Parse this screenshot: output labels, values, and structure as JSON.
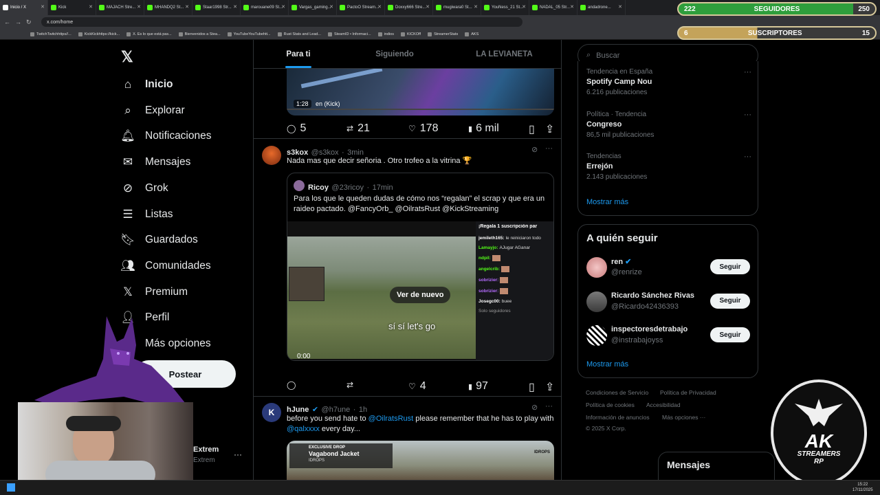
{
  "browser": {
    "tabs": [
      "Inicio / X",
      "Kick",
      "MAJACH Stre...",
      "MHANDQ2 St...",
      "Staar1998 Str...",
      "marouane09 St...",
      "Vargas_gaming...",
      "PactoO Stream...",
      "Doxxy666 Stre...",
      "mugiwara0 St...",
      "YouNess_21 St...",
      "NADAL_05 Str...",
      "andadrone..."
    ],
    "url": "x.com/home",
    "bookmarks": [
      "TwitchTwitchhttps//...",
      "KickKickhttps://kick...",
      "X. Es lo que está pas...",
      "Bienvenidos a Stea...",
      "YouTubeYouTubehtt...",
      "Rust Stats and Lead...",
      "SteamID • Informaci...",
      "indios",
      "KICKOff",
      "StreamerStats",
      "AKS"
    ]
  },
  "overlay": {
    "followers": {
      "current": "222",
      "label": "SEGUIDORES",
      "goal": "250",
      "progress": 0.888
    },
    "subs": {
      "current": "6",
      "label": "SUSCRIPTORES",
      "goal": "15",
      "progress": 0.4
    },
    "logo_text": [
      "AK",
      "STREAMERS",
      "RP"
    ],
    "webcam_user": "Extrem",
    "webcam_handle": "Extrem"
  },
  "sidebar": {
    "items": [
      {
        "label": "Inicio",
        "icon": "home-icon"
      },
      {
        "label": "Explorar",
        "icon": "search-icon"
      },
      {
        "label": "Notificaciones",
        "icon": "bell-icon"
      },
      {
        "label": "Mensajes",
        "icon": "mail-icon"
      },
      {
        "label": "Grok",
        "icon": "grok-icon"
      },
      {
        "label": "Listas",
        "icon": "list-icon"
      },
      {
        "label": "Guardados",
        "icon": "bookmark-icon"
      },
      {
        "label": "Comunidades",
        "icon": "communities-icon"
      },
      {
        "label": "Premium",
        "icon": "x-logo-icon"
      },
      {
        "label": "Perfil",
        "icon": "profile-icon"
      },
      {
        "label": "Más opciones",
        "icon": "more-icon"
      }
    ],
    "post_button": "Postear",
    "more_dots": "···"
  },
  "feed": {
    "tabs": [
      "Para ti",
      "Siguiendo",
      "LA LEVIANETA"
    ],
    "video_top": {
      "duration": "1:28",
      "overlay_text": "en (Kick)"
    },
    "actions_1": {
      "replies": "5",
      "reposts": "21",
      "likes": "178",
      "views": "6 mil"
    },
    "tweet1": {
      "name": "s3kox",
      "handle": "@s3kox",
      "time": "3min",
      "text": "Nada mas que decir señoria . Otro trofeo a la vitrina 🏆",
      "quote": {
        "name": "Ricoy",
        "handle": "@23ricoy",
        "time": "17min",
        "text_prefix": "Para los que le queden dudas de cómo nos “regalan” el scrap y que era un raideo pactado. ",
        "mentions": "@FancyOrb_ @OilratsRust @KickStreaming",
        "replay": "Ver de nuevo",
        "subtitle": "sí sí let's go",
        "time_display": "0:00",
        "chat_header": "¡Regala 1 suscripción par",
        "chat": [
          {
            "user": "jemileth165:",
            "msg": "le reiniciaron todo"
          },
          {
            "user": "Lamayjo:",
            "msg": "AJugar AGanar"
          },
          {
            "user": "ndpil:",
            "msg": ""
          },
          {
            "user": "angelcrib:",
            "msg": ""
          },
          {
            "user": "sobrizier:",
            "msg": ""
          },
          {
            "user": "sobrizier:",
            "msg": ""
          },
          {
            "user": "Josegc00:",
            "msg": "buee"
          }
        ],
        "chat_footer": "Solo seguidores"
      },
      "actions": {
        "replies": "",
        "reposts": "",
        "likes": "4",
        "views": "97"
      }
    },
    "tweet2": {
      "name": "hJune",
      "handle": "@h7une",
      "time": "1h",
      "text_a": "before you send hate to ",
      "mention_a": "@OilratsRust",
      "text_b": " please remember that he has to play with ",
      "mention_b": "@qalxxxx",
      "text_c": " every day...",
      "media_title": "Vagabond Jacket",
      "media_tag": "EXCLUSIVE DROP",
      "media_sub": "IDROPS",
      "media_corner": "IDROPS"
    }
  },
  "right": {
    "search_placeholder": "Buscar",
    "trends": [
      {
        "category": "Tendencia en España",
        "name": "Spotify Camp Nou",
        "count": "6.216 publicaciones"
      },
      {
        "category": "Política · Tendencia",
        "name": "Congreso",
        "count": "86,5 mil publicaciones"
      },
      {
        "category": "Tendencias",
        "name": "Errejón",
        "count": "2.143 publicaciones"
      }
    ],
    "show_more": "Mostrar más",
    "who_to_follow_title": "A quién seguir",
    "follow": [
      {
        "name": "ren",
        "handle": "@renrize",
        "verified": true
      },
      {
        "name": "Ricardo Sánchez Rivas",
        "handle": "@Ricardo42436393",
        "verified": false
      },
      {
        "name": "inspectoresdetrabajo",
        "handle": "@instrabajoyss",
        "verified": false
      }
    ],
    "follow_button": "Seguir",
    "show_more_2": "Mostrar más",
    "footer": [
      "Condiciones de Servicio",
      "Política de Privacidad",
      "Política de cookies",
      "Accesibilidad",
      "Información de anuncios",
      "Más opciones ···",
      "© 2025 X Corp."
    ],
    "messages": "Mensajes"
  },
  "taskbar": {
    "time": "15:22",
    "date": "17/11/2025"
  },
  "colors": {
    "accent": "#1d9bf0",
    "kick": "#53fc18",
    "bg": "#000000",
    "overlay_green": "#2e9e3c"
  }
}
